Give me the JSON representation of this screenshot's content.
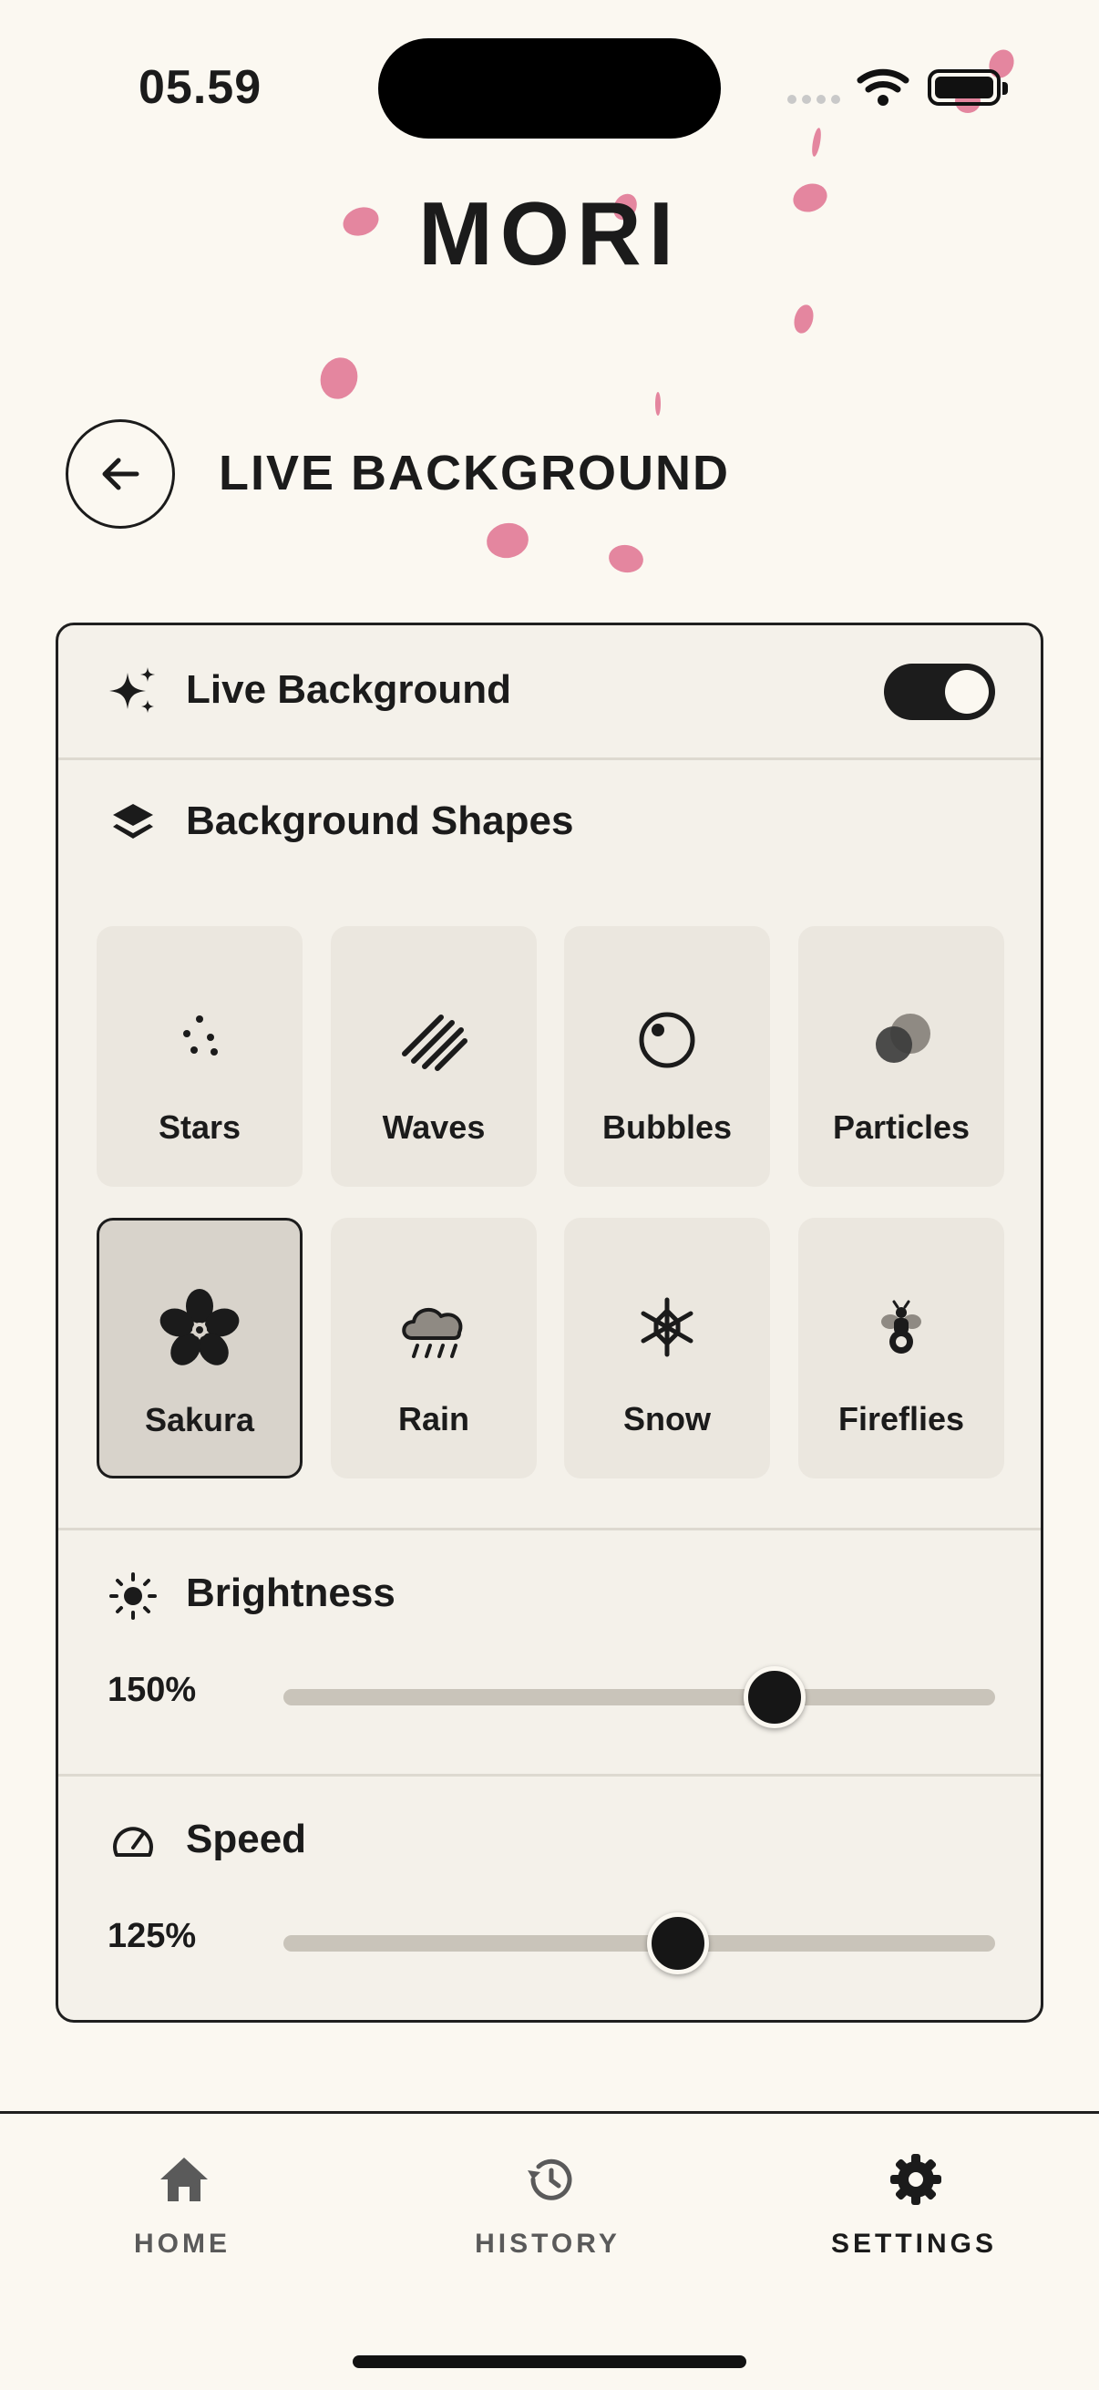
{
  "status_bar": {
    "time": "05.59"
  },
  "app": {
    "title": "MORI"
  },
  "header": {
    "title": "LIVE BACKGROUND",
    "back_icon": "arrow-left-icon"
  },
  "live_background": {
    "label": "Live Background",
    "icon": "sparkles-icon",
    "enabled": true
  },
  "shapes": {
    "label": "Background Shapes",
    "icon": "layers-icon",
    "selected": "Sakura",
    "items": [
      {
        "label": "Stars",
        "icon": "stars-icon"
      },
      {
        "label": "Waves",
        "icon": "waves-icon"
      },
      {
        "label": "Bubbles",
        "icon": "bubbles-icon"
      },
      {
        "label": "Particles",
        "icon": "particles-icon"
      },
      {
        "label": "Sakura",
        "icon": "sakura-flower-icon"
      },
      {
        "label": "Rain",
        "icon": "rain-cloud-icon"
      },
      {
        "label": "Snow",
        "icon": "snowflake-icon"
      },
      {
        "label": "Fireflies",
        "icon": "firefly-icon"
      }
    ]
  },
  "brightness": {
    "label": "Brightness",
    "icon": "sun-icon",
    "value": "150%",
    "fraction": 0.69
  },
  "speed": {
    "label": "Speed",
    "icon": "speedometer-icon",
    "value": "125%",
    "fraction": 0.555
  },
  "tabbar": {
    "active": "SETTINGS",
    "items": [
      {
        "label": "HOME",
        "icon": "home-icon"
      },
      {
        "label": "HISTORY",
        "icon": "history-icon"
      },
      {
        "label": "SETTINGS",
        "icon": "gear-icon"
      }
    ]
  },
  "colors": {
    "background": "#fbf8f1",
    "accent": "#1c1c1c",
    "petal": "#e27c98",
    "card": "#f4f1ea"
  }
}
